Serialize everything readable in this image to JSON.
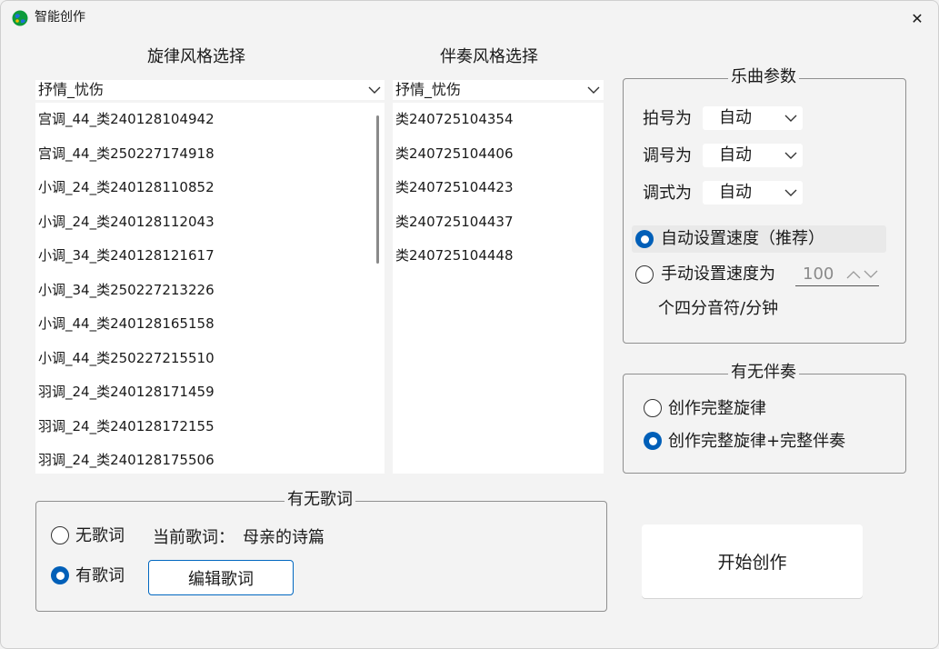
{
  "window": {
    "title": "智能创作",
    "close": "✕"
  },
  "melody": {
    "heading": "旋律风格选择",
    "style_selected": "抒情_忧伤",
    "items": [
      "宫调_44_类240128104942",
      "宫调_44_类250227174918",
      "小调_24_类240128110852",
      "小调_24_类240128112043",
      "小调_34_类240128121617",
      "小调_34_类250227213226",
      "小调_44_类240128165158",
      "小调_44_类250227215510",
      "羽调_24_类240128171459",
      "羽调_24_类240128172155",
      "羽调_24_类240128175506"
    ]
  },
  "accompaniment": {
    "heading": "伴奏风格选择",
    "style_selected": "抒情_忧伤",
    "items": [
      "类240725104354",
      "类240725104406",
      "类240725104423",
      "类240725104437",
      "类240725104448"
    ]
  },
  "params": {
    "legend": "乐曲参数",
    "meter_label": "拍号为",
    "meter_value": "自动",
    "key_label": "调号为",
    "key_value": "自动",
    "mode_label": "调式为",
    "mode_value": "自动",
    "auto_speed_label": "自动设置速度（推荐）",
    "manual_speed_label": "手动设置速度为",
    "speed_value": "100",
    "speed_unit": "个四分音符/分钟"
  },
  "accomp_option": {
    "legend": "有无伴奏",
    "melody_only": "创作完整旋律",
    "melody_with_accomp": "创作完整旋律+完整伴奏"
  },
  "lyrics": {
    "legend": "有无歌词",
    "no_lyrics": "无歌词",
    "has_lyrics": "有歌词",
    "current_label": "当前歌词：",
    "current_value": "母亲的诗篇",
    "edit_button": "编辑歌词"
  },
  "start_button": "开始创作",
  "colors": {
    "accent": "#005fb8",
    "window_bg": "#f3f3f3"
  },
  "icons": {
    "app": "globe-icon",
    "chevron": "chevron-down-icon",
    "spin": "spin-up-down-icon"
  }
}
